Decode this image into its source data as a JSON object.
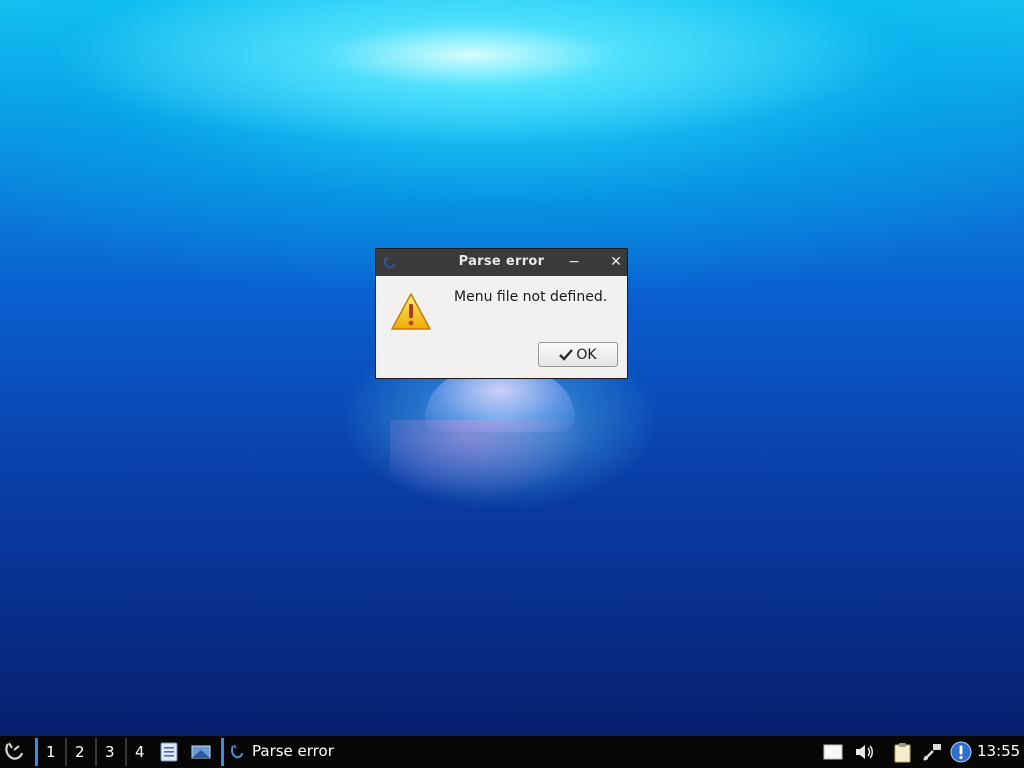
{
  "dialog": {
    "title": "Parse error",
    "minimize_glyph": "−",
    "close_glyph": "✕",
    "message": "Menu file not defined.",
    "ok_label": "OK",
    "icon": "warning-icon"
  },
  "taskbar": {
    "workspaces": [
      "1",
      "2",
      "3",
      "4"
    ],
    "active_workspace": "1",
    "task_label": "Parse error",
    "clock": "13:55",
    "tray_icons": [
      "document-icon",
      "volume-icon",
      "clipboard-icon",
      "network-icon",
      "update-notification-icon"
    ]
  },
  "colors": {
    "accent": "#3a8ee6",
    "titlebar": "#3a3a3a",
    "taskbar": "#060606",
    "dialog_bg": "#f2f1f0"
  }
}
